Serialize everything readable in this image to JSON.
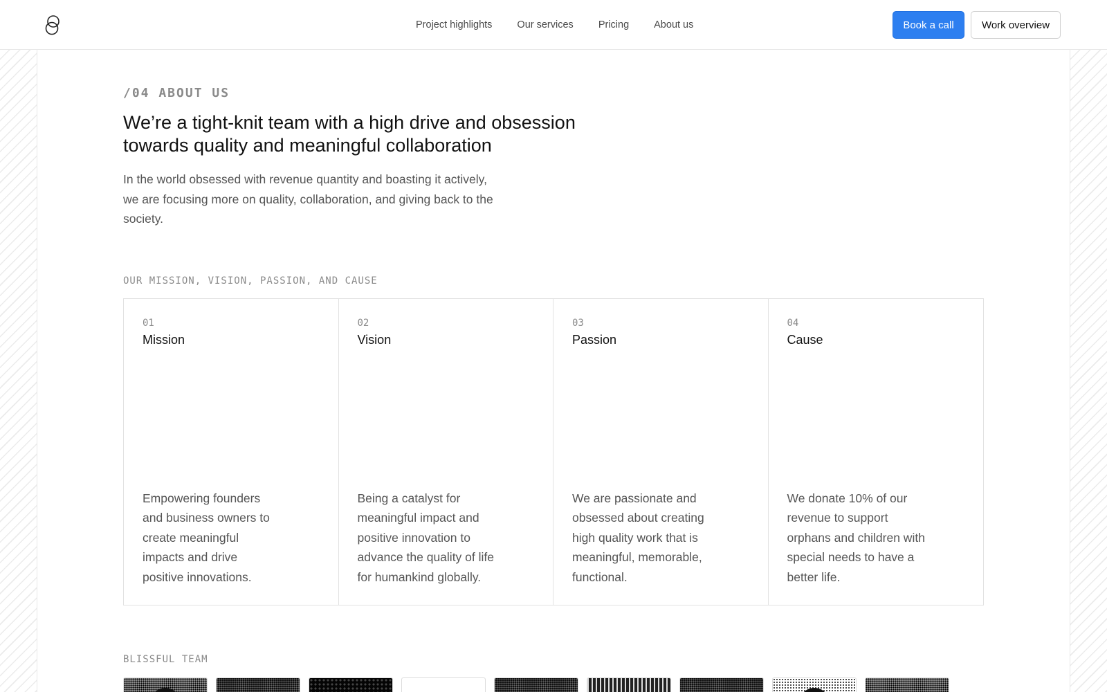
{
  "header": {
    "nav": [
      "Project highlights",
      "Our services",
      "Pricing",
      "About us"
    ],
    "primary_button": "Book a call",
    "secondary_button": "Work overview"
  },
  "about": {
    "tag": "/04 ABOUT US",
    "headline_line1": "We’re a tight-knit team with a high drive and obsession",
    "headline_line2": "towards quality and meaningful collaboration",
    "intro": "In the world obsessed with revenue quantity and boasting it actively, we are focusing more on quality, collaboration, and giving back to the society."
  },
  "mission_section": {
    "label": "OUR MISSION, VISION, PASSION, AND CAUSE",
    "cards": [
      {
        "number": "01",
        "title": "Mission",
        "text": "Empowering founders and business owners to create meaningful impacts and drive positive innovations."
      },
      {
        "number": "02",
        "title": "Vision",
        "text": "Being a catalyst for meaningful impact and positive innovation to advance the quality of life for humankind globally."
      },
      {
        "number": "03",
        "title": "Passion",
        "text": "We are passionate and obsessed about creating high quality work that is meaningful, memorable, functional."
      },
      {
        "number": "04",
        "title": "Cause",
        "text": "We donate 10% of our revenue to support orphans and children with special needs to have a better life."
      }
    ]
  },
  "team": {
    "label": "BLISSFUL TEAM"
  },
  "colors": {
    "accent": "#2d7ff0",
    "muted_text": "#555555",
    "label_gray": "#8a8a8a"
  },
  "icons": {
    "logo": "brand-logo-icon"
  }
}
